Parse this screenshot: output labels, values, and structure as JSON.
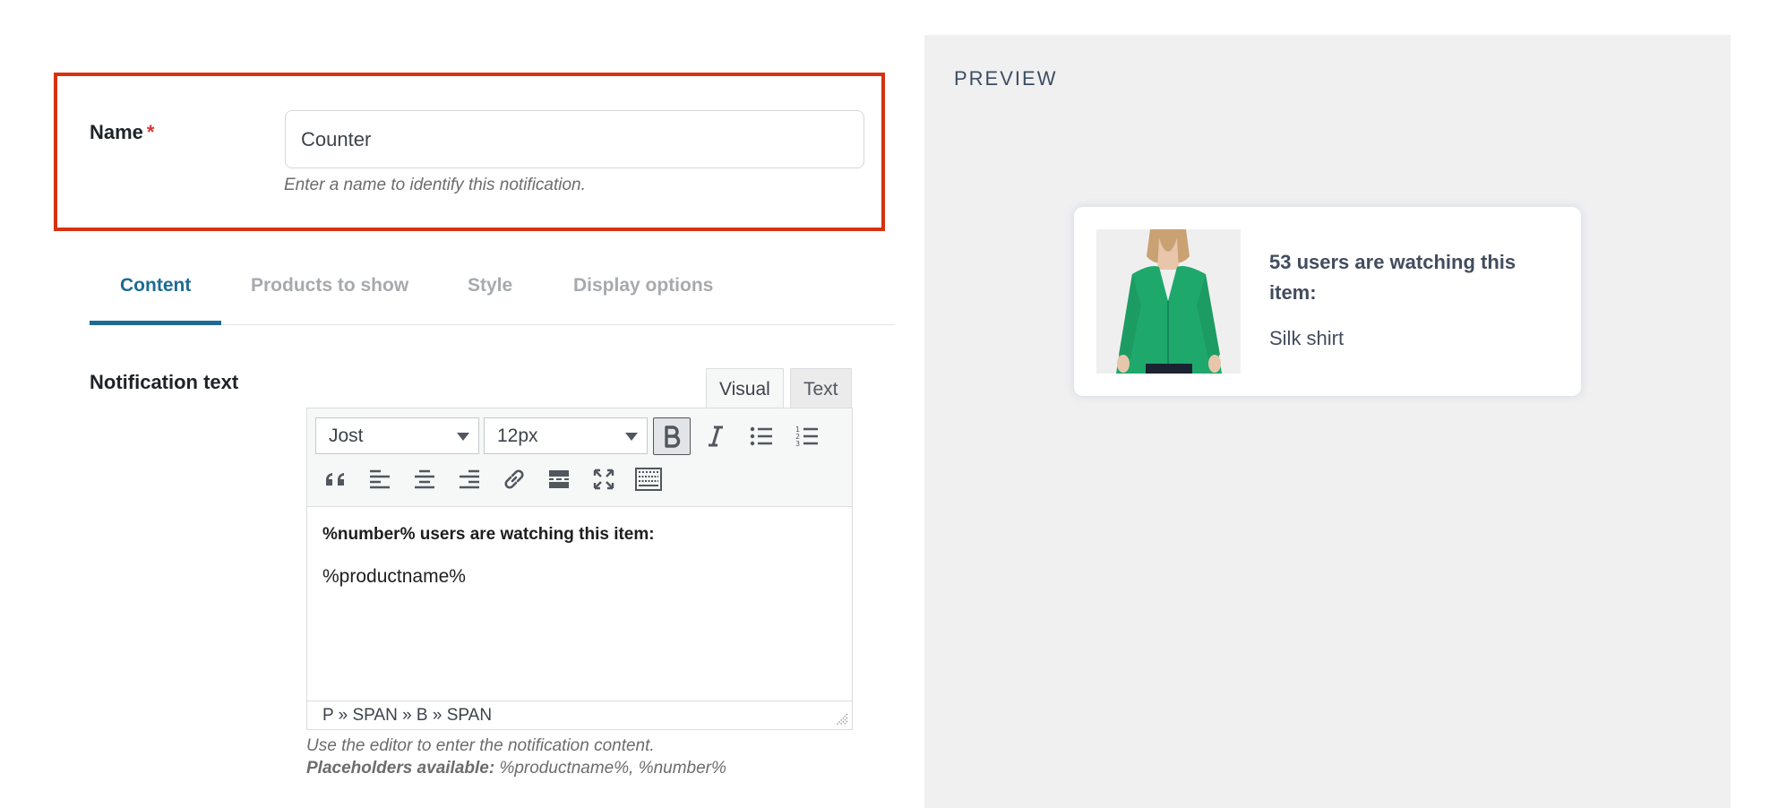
{
  "name_field": {
    "label": "Name",
    "required_marker": "*",
    "value": "Counter",
    "help": "Enter a name to identify this notification."
  },
  "tabs": [
    {
      "label": "Content",
      "active": true
    },
    {
      "label": "Products to show",
      "active": false
    },
    {
      "label": "Style",
      "active": false
    },
    {
      "label": "Display options",
      "active": false
    }
  ],
  "notification": {
    "label": "Notification text",
    "mode_tabs": {
      "visual": "Visual",
      "text": "Text"
    },
    "toolbar": {
      "font": "Jost",
      "size": "12px",
      "buttons": [
        "bold-icon",
        "italic-icon",
        "bullet-list-icon",
        "numbered-list-icon",
        "blockquote-icon",
        "align-left-icon",
        "align-center-icon",
        "align-right-icon",
        "link-icon",
        "read-more-icon",
        "fullscreen-icon",
        "toolbar-toggle-icon"
      ]
    },
    "content_line1": "%number% users are watching this item:",
    "content_line2": "%productname%",
    "path": "P » SPAN » B » SPAN",
    "help1": "Use the editor to enter the notification content.",
    "help2_label": "Placeholders available:",
    "help2_values": " %productname%, %number%"
  },
  "preview": {
    "title": "PREVIEW",
    "heading": "53 users are watching this item:",
    "product": "Silk shirt"
  },
  "colors": {
    "accent": "#1d6b93",
    "highlight_border": "#d63210",
    "required": "#d63638",
    "preview_bg": "#f0f0f1"
  }
}
